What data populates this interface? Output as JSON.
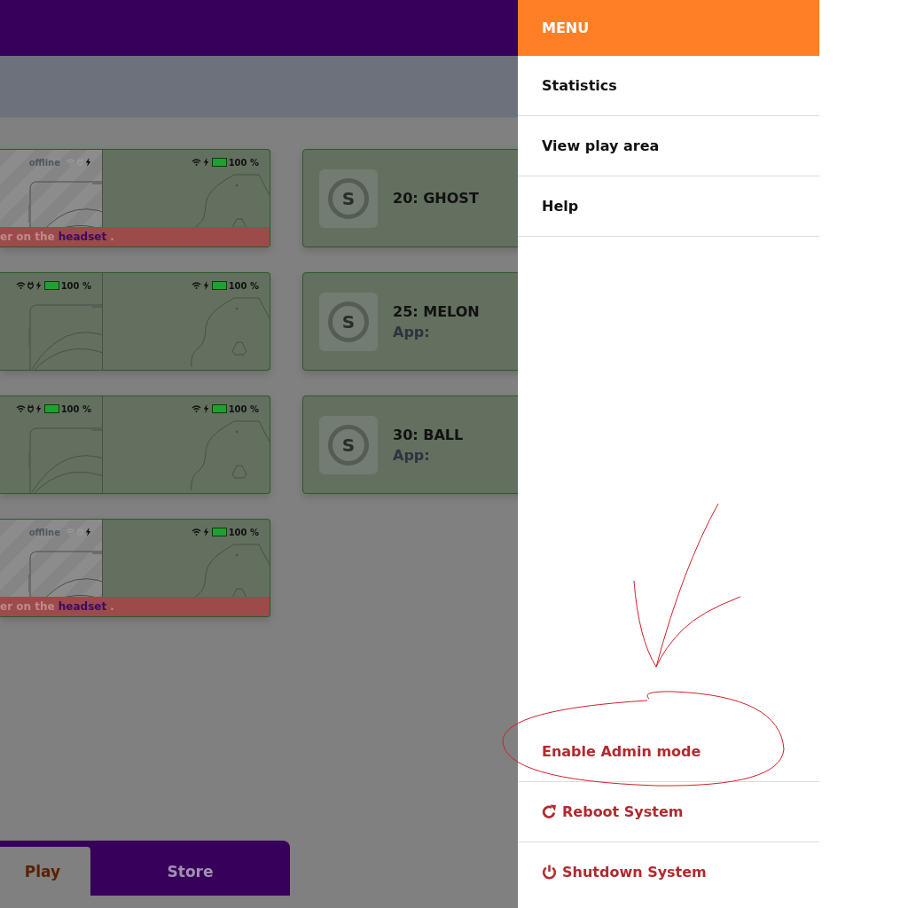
{
  "devices": [
    {
      "headset": {
        "online": false,
        "status": "offline"
      },
      "controller": {
        "level": 1,
        "reading": "100 %"
      },
      "warning": {
        "before": "er on the ",
        "link": "headset",
        "after": " ."
      }
    },
    {
      "headset": {
        "online": true,
        "level": 1,
        "reading": "100 %"
      },
      "controller": {
        "level": 1,
        "reading": "100 %"
      }
    },
    {
      "headset": {
        "online": true,
        "level": 1,
        "reading": "100 %"
      },
      "controller": {
        "level": 1,
        "reading": "100 %"
      }
    },
    {
      "headset": {
        "online": false,
        "status": "offline"
      },
      "controller": {
        "level": 1,
        "reading": "100 %"
      },
      "warning": {
        "before": "er on the ",
        "link": "headset",
        "after": " ."
      }
    }
  ],
  "stations": [
    {
      "logo": "S",
      "title": "20: GHOST"
    },
    {
      "logo": "S",
      "title": "25: MELON",
      "app": "App:"
    },
    {
      "logo": "S",
      "title": "30: BALL",
      "app": "App:"
    }
  ],
  "tabs": [
    {
      "label": "Play",
      "selected": true
    },
    {
      "label": "Store",
      "selected": false
    }
  ],
  "menu": {
    "title": "MENU",
    "items": [
      {
        "label": "Statistics"
      },
      {
        "label": "View play area"
      },
      {
        "label": "Help"
      }
    ],
    "actions": [
      {
        "label": "Enable Admin mode",
        "kind": "admin"
      },
      {
        "label": "Reboot System",
        "kind": "reboot"
      },
      {
        "label": "Shutdown System",
        "kind": "shutdown"
      }
    ]
  }
}
